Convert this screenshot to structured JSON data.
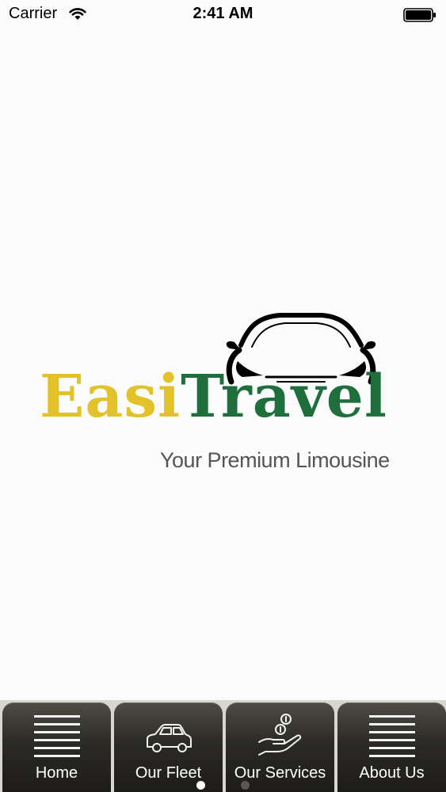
{
  "status_bar": {
    "carrier": "Carrier",
    "time": "2:41 AM"
  },
  "logo": {
    "brand_part1": "Easi",
    "brand_part2": "Travel",
    "tagline": "Your Premium Limousine",
    "colors": {
      "easi": "#e3c128",
      "travel": "#1f6f3c",
      "tagline": "#555555"
    }
  },
  "tab_bar": {
    "tabs": [
      {
        "label": "Home",
        "icon": "menu-lines-icon"
      },
      {
        "label": "Our Fleet",
        "icon": "car-icon"
      },
      {
        "label": "Our Services",
        "icon": "hand-coins-icon"
      },
      {
        "label": "About Us",
        "icon": "menu-lines-icon"
      }
    ],
    "page_indicator": {
      "pages": 2,
      "active_page": 1
    }
  }
}
